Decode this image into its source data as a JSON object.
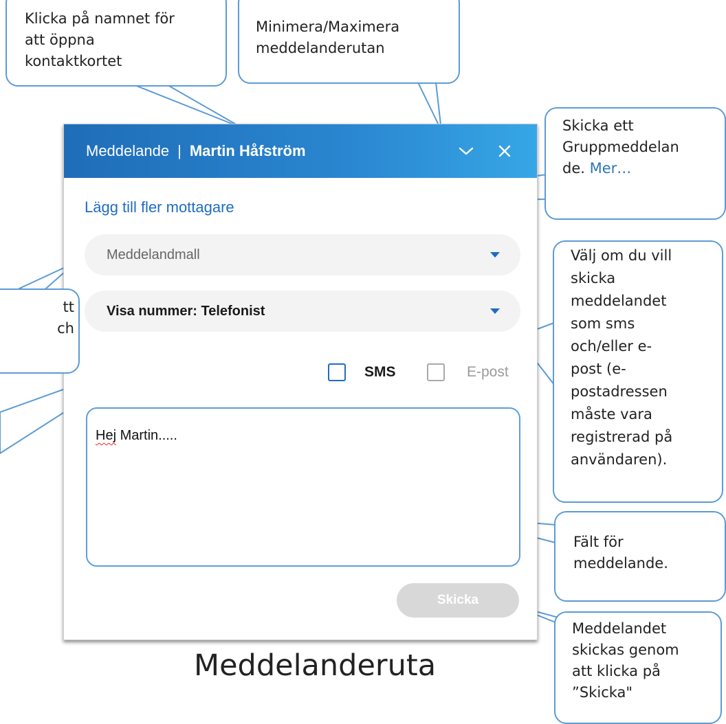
{
  "dialog": {
    "app_title": "Meddelande",
    "separator": "|",
    "contact_name": "Martin Håfström",
    "add_recipients_label": "Lägg till fler mottagare",
    "template_select": "Meddelandmall",
    "number_select": "Visa nummer: Telefonist",
    "sms_label": "SMS",
    "sms_checked": false,
    "email_label": "E-post",
    "email_checked": false,
    "message_word_1": "Hej",
    "message_rest": " Martin.....",
    "send_label": "Skicka",
    "colors": {
      "titlebar_start": "#1f6db8",
      "titlebar_end": "#36a6e6",
      "accent": "#1f6cc3",
      "send_disabled": "#d8d8d8"
    },
    "icons": [
      "chevron-down-icon",
      "close-icon",
      "dropdown-caret-icon"
    ]
  },
  "caption": "Meddelanderuta",
  "callouts": {
    "name": [
      "Klicka på namnet för",
      "att öppna",
      "kontaktkortet"
    ],
    "minimize": [
      "Minimera/Maximera",
      "meddelanderutan"
    ],
    "group": [
      "Skicka ett",
      "Gruppmeddelan"
    ],
    "group_last_prefix": "de. ",
    "group_more": "Mer…",
    "choose": [
      "Välj om du vill",
      "skicka",
      "meddelandet",
      "som sms",
      "och/eller e-",
      "post (e-",
      "postadressen",
      "måste vara",
      "registrerad på",
      "användaren)."
    ],
    "field": [
      "Fält för",
      "meddelande."
    ],
    "send": [
      "Meddelandet",
      "skickas genom",
      "att klicka på",
      "”Skicka\""
    ],
    "left_partial": [
      "tt",
      "ch"
    ]
  }
}
